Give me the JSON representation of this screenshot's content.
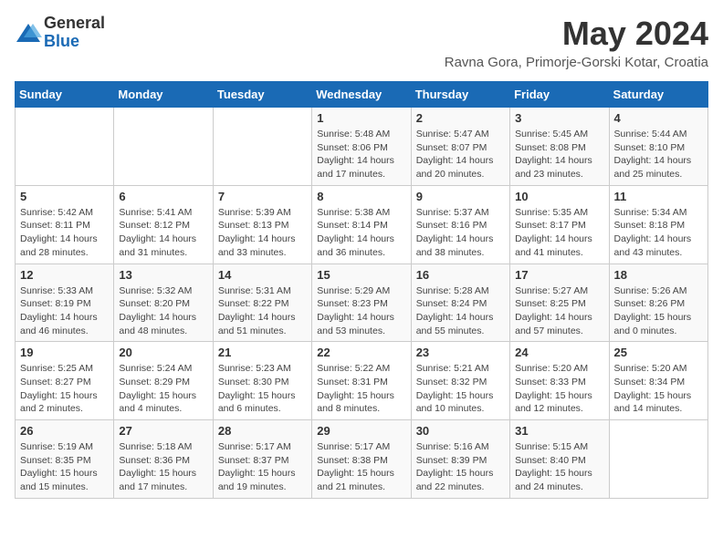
{
  "header": {
    "logo_general": "General",
    "logo_blue": "Blue",
    "month_year": "May 2024",
    "location": "Ravna Gora, Primorje-Gorski Kotar, Croatia"
  },
  "days_of_week": [
    "Sunday",
    "Monday",
    "Tuesday",
    "Wednesday",
    "Thursday",
    "Friday",
    "Saturday"
  ],
  "weeks": [
    {
      "days": [
        {
          "number": "",
          "sunrise": "",
          "sunset": "",
          "daylight": ""
        },
        {
          "number": "",
          "sunrise": "",
          "sunset": "",
          "daylight": ""
        },
        {
          "number": "",
          "sunrise": "",
          "sunset": "",
          "daylight": ""
        },
        {
          "number": "1",
          "sunrise": "Sunrise: 5:48 AM",
          "sunset": "Sunset: 8:06 PM",
          "daylight": "Daylight: 14 hours and 17 minutes."
        },
        {
          "number": "2",
          "sunrise": "Sunrise: 5:47 AM",
          "sunset": "Sunset: 8:07 PM",
          "daylight": "Daylight: 14 hours and 20 minutes."
        },
        {
          "number": "3",
          "sunrise": "Sunrise: 5:45 AM",
          "sunset": "Sunset: 8:08 PM",
          "daylight": "Daylight: 14 hours and 23 minutes."
        },
        {
          "number": "4",
          "sunrise": "Sunrise: 5:44 AM",
          "sunset": "Sunset: 8:10 PM",
          "daylight": "Daylight: 14 hours and 25 minutes."
        }
      ]
    },
    {
      "days": [
        {
          "number": "5",
          "sunrise": "Sunrise: 5:42 AM",
          "sunset": "Sunset: 8:11 PM",
          "daylight": "Daylight: 14 hours and 28 minutes."
        },
        {
          "number": "6",
          "sunrise": "Sunrise: 5:41 AM",
          "sunset": "Sunset: 8:12 PM",
          "daylight": "Daylight: 14 hours and 31 minutes."
        },
        {
          "number": "7",
          "sunrise": "Sunrise: 5:39 AM",
          "sunset": "Sunset: 8:13 PM",
          "daylight": "Daylight: 14 hours and 33 minutes."
        },
        {
          "number": "8",
          "sunrise": "Sunrise: 5:38 AM",
          "sunset": "Sunset: 8:14 PM",
          "daylight": "Daylight: 14 hours and 36 minutes."
        },
        {
          "number": "9",
          "sunrise": "Sunrise: 5:37 AM",
          "sunset": "Sunset: 8:16 PM",
          "daylight": "Daylight: 14 hours and 38 minutes."
        },
        {
          "number": "10",
          "sunrise": "Sunrise: 5:35 AM",
          "sunset": "Sunset: 8:17 PM",
          "daylight": "Daylight: 14 hours and 41 minutes."
        },
        {
          "number": "11",
          "sunrise": "Sunrise: 5:34 AM",
          "sunset": "Sunset: 8:18 PM",
          "daylight": "Daylight: 14 hours and 43 minutes."
        }
      ]
    },
    {
      "days": [
        {
          "number": "12",
          "sunrise": "Sunrise: 5:33 AM",
          "sunset": "Sunset: 8:19 PM",
          "daylight": "Daylight: 14 hours and 46 minutes."
        },
        {
          "number": "13",
          "sunrise": "Sunrise: 5:32 AM",
          "sunset": "Sunset: 8:20 PM",
          "daylight": "Daylight: 14 hours and 48 minutes."
        },
        {
          "number": "14",
          "sunrise": "Sunrise: 5:31 AM",
          "sunset": "Sunset: 8:22 PM",
          "daylight": "Daylight: 14 hours and 51 minutes."
        },
        {
          "number": "15",
          "sunrise": "Sunrise: 5:29 AM",
          "sunset": "Sunset: 8:23 PM",
          "daylight": "Daylight: 14 hours and 53 minutes."
        },
        {
          "number": "16",
          "sunrise": "Sunrise: 5:28 AM",
          "sunset": "Sunset: 8:24 PM",
          "daylight": "Daylight: 14 hours and 55 minutes."
        },
        {
          "number": "17",
          "sunrise": "Sunrise: 5:27 AM",
          "sunset": "Sunset: 8:25 PM",
          "daylight": "Daylight: 14 hours and 57 minutes."
        },
        {
          "number": "18",
          "sunrise": "Sunrise: 5:26 AM",
          "sunset": "Sunset: 8:26 PM",
          "daylight": "Daylight: 15 hours and 0 minutes."
        }
      ]
    },
    {
      "days": [
        {
          "number": "19",
          "sunrise": "Sunrise: 5:25 AM",
          "sunset": "Sunset: 8:27 PM",
          "daylight": "Daylight: 15 hours and 2 minutes."
        },
        {
          "number": "20",
          "sunrise": "Sunrise: 5:24 AM",
          "sunset": "Sunset: 8:29 PM",
          "daylight": "Daylight: 15 hours and 4 minutes."
        },
        {
          "number": "21",
          "sunrise": "Sunrise: 5:23 AM",
          "sunset": "Sunset: 8:30 PM",
          "daylight": "Daylight: 15 hours and 6 minutes."
        },
        {
          "number": "22",
          "sunrise": "Sunrise: 5:22 AM",
          "sunset": "Sunset: 8:31 PM",
          "daylight": "Daylight: 15 hours and 8 minutes."
        },
        {
          "number": "23",
          "sunrise": "Sunrise: 5:21 AM",
          "sunset": "Sunset: 8:32 PM",
          "daylight": "Daylight: 15 hours and 10 minutes."
        },
        {
          "number": "24",
          "sunrise": "Sunrise: 5:20 AM",
          "sunset": "Sunset: 8:33 PM",
          "daylight": "Daylight: 15 hours and 12 minutes."
        },
        {
          "number": "25",
          "sunrise": "Sunrise: 5:20 AM",
          "sunset": "Sunset: 8:34 PM",
          "daylight": "Daylight: 15 hours and 14 minutes."
        }
      ]
    },
    {
      "days": [
        {
          "number": "26",
          "sunrise": "Sunrise: 5:19 AM",
          "sunset": "Sunset: 8:35 PM",
          "daylight": "Daylight: 15 hours and 15 minutes."
        },
        {
          "number": "27",
          "sunrise": "Sunrise: 5:18 AM",
          "sunset": "Sunset: 8:36 PM",
          "daylight": "Daylight: 15 hours and 17 minutes."
        },
        {
          "number": "28",
          "sunrise": "Sunrise: 5:17 AM",
          "sunset": "Sunset: 8:37 PM",
          "daylight": "Daylight: 15 hours and 19 minutes."
        },
        {
          "number": "29",
          "sunrise": "Sunrise: 5:17 AM",
          "sunset": "Sunset: 8:38 PM",
          "daylight": "Daylight: 15 hours and 21 minutes."
        },
        {
          "number": "30",
          "sunrise": "Sunrise: 5:16 AM",
          "sunset": "Sunset: 8:39 PM",
          "daylight": "Daylight: 15 hours and 22 minutes."
        },
        {
          "number": "31",
          "sunrise": "Sunrise: 5:15 AM",
          "sunset": "Sunset: 8:40 PM",
          "daylight": "Daylight: 15 hours and 24 minutes."
        },
        {
          "number": "",
          "sunrise": "",
          "sunset": "",
          "daylight": ""
        }
      ]
    }
  ]
}
